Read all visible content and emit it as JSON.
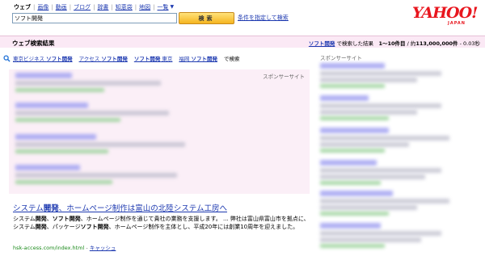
{
  "nav": {
    "items": [
      {
        "label": "ウェブ",
        "active": true
      },
      {
        "label": "画像",
        "active": false
      },
      {
        "label": "動画",
        "active": false
      },
      {
        "label": "ブログ",
        "active": false
      },
      {
        "label": "辞書",
        "active": false
      },
      {
        "label": "知恵袋",
        "active": false
      },
      {
        "label": "地図",
        "active": false
      }
    ],
    "more_label": "一覧"
  },
  "search": {
    "query": "ソフト開発",
    "button_label": "検索",
    "advanced_link": "条件を指定して検索"
  },
  "logo": {
    "main": "YAHOO!",
    "sub": "JAPAN"
  },
  "result_bar": {
    "title": "ウェブ検索結果",
    "query": "ソフト開発",
    "stats_prefix": "で検索した結果",
    "range": "1～10件目",
    "total_prefix": "/ 約",
    "total": "113,000,000件",
    "time": "- 0.03秒"
  },
  "related": {
    "items": [
      {
        "pre": "東京ビジネス ",
        "bold": "ソフト開発"
      },
      {
        "pre": "アクセス ",
        "bold": "ソフト開発"
      },
      {
        "pre": "",
        "bold": "ソフト開発",
        "post": " 東京"
      },
      {
        "pre": "福岡 ",
        "bold": "ソフト開発"
      }
    ],
    "tail": "で検索"
  },
  "sponsor": {
    "label": "スポンサーサイト",
    "right_label": "スポンサーサイト"
  },
  "result": {
    "title_parts": [
      {
        "t": "システム",
        "b": false
      },
      {
        "t": "開発",
        "b": true
      },
      {
        "t": "、ホームページ制作は富山の北陸システム工房へ",
        "b": false
      }
    ],
    "snippet_parts": [
      {
        "t": "システム",
        "b": false
      },
      {
        "t": "開発",
        "b": true
      },
      {
        "t": "、",
        "b": false
      },
      {
        "t": "ソフト開発",
        "b": true
      },
      {
        "t": "、ホームページ制作を通じて貴社の業務を支援します。 ... 弊社は富山県富山市を拠点に、システム",
        "b": false
      },
      {
        "t": "開発",
        "b": true
      },
      {
        "t": "、パッケージ",
        "b": false
      },
      {
        "t": "ソフト開発",
        "b": true
      },
      {
        "t": "、ホームページ制作を主体とし、平成20年には創業10周年を迎えました。",
        "b": false
      }
    ],
    "url": "hsk-access.com/index.html",
    "separator": "-",
    "cache_label": "キャッシュ"
  },
  "colors": {
    "link": "#1d39b0",
    "url_green": "#1a8a1a",
    "sponsor_bg": "#fbeff7",
    "logo_red": "#e8161e"
  }
}
